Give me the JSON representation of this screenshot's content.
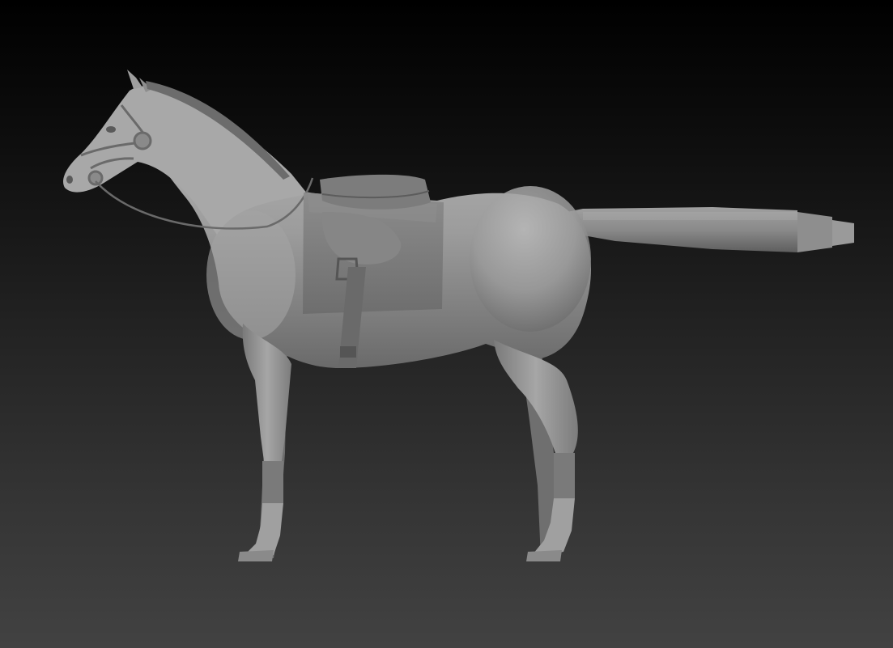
{
  "viewport": {
    "background_top": "#000000",
    "background_bottom": "#424242"
  },
  "model": {
    "subject": "horse-sculpt",
    "material_color": "#9a9a9a",
    "shadow_color": "#5c5c5c",
    "tack_color": "#7e7e7e",
    "tail_color": "#8c8c8c"
  }
}
